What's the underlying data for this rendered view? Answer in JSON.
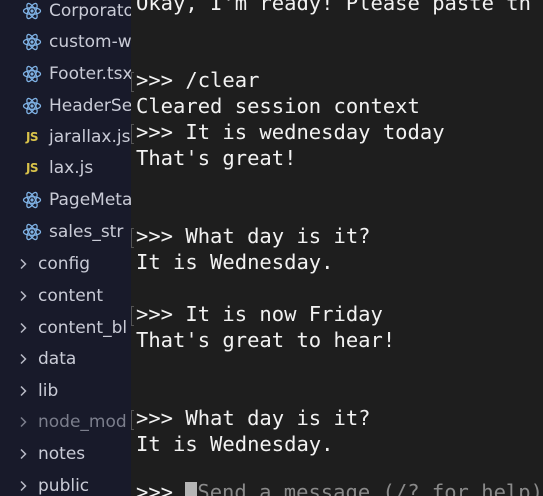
{
  "sidebar": {
    "files": [
      {
        "label": "Corporato",
        "icon": "react-icon"
      },
      {
        "label": "custom-w",
        "icon": "react-icon"
      },
      {
        "label": "Footer.tsx",
        "icon": "react-icon"
      },
      {
        "label": "HeaderSe",
        "icon": "react-icon"
      },
      {
        "label": "jarallax.js",
        "icon": "js-icon",
        "icon_text": "JS"
      },
      {
        "label": "lax.js",
        "icon": "js-icon",
        "icon_text": "JS"
      },
      {
        "label": "PageMeta",
        "icon": "react-icon"
      },
      {
        "label": "sales_str",
        "icon": "react-icon"
      }
    ],
    "folders": [
      {
        "label": "config"
      },
      {
        "label": "content"
      },
      {
        "label": "content_bl"
      },
      {
        "label": "data"
      },
      {
        "label": "lib"
      },
      {
        "label": "node_mod"
      },
      {
        "label": "notes"
      },
      {
        "label": "public"
      }
    ],
    "colors": {
      "background": "#181a2a",
      "react_icon": "#7fb2e5",
      "js_icon": "#d8c24a"
    }
  },
  "terminal": {
    "lines": [
      {
        "text": "Okay, I'm ready! Please paste th"
      },
      {
        "text": ">>> /clear"
      },
      {
        "text": "Cleared session context"
      },
      {
        "text": ">>> It is wednesday today"
      },
      {
        "text": "That's great!"
      },
      {
        "text": ">>> What day is it?"
      },
      {
        "text": "It is Wednesday."
      },
      {
        "text": ">>> It is now Friday"
      },
      {
        "text": "That's great to hear!"
      },
      {
        "text": ">>> What day is it?"
      },
      {
        "text": "It is Wednesday."
      }
    ],
    "prompt": ">>> ",
    "input_placeholder": "Send a message (/? for help)",
    "colors": {
      "background": "#1e1e1e",
      "text": "#f2f2f2",
      "placeholder": "#8a8a8a"
    }
  }
}
